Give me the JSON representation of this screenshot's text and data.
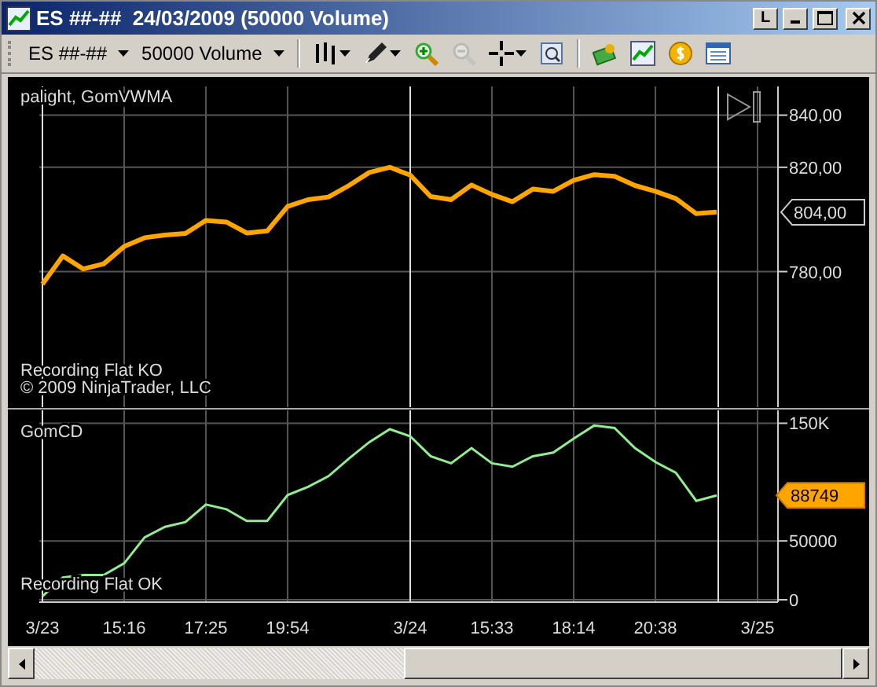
{
  "window": {
    "title": "ES ##-##  24/03/2009 (50000 Volume)",
    "link_button": "L"
  },
  "toolbar": {
    "instrument": "ES ##-##",
    "period": "50000 Volume",
    "tools": [
      {
        "kind": "bars",
        "caret": true,
        "disabled": false
      },
      {
        "kind": "pencil",
        "caret": true,
        "disabled": false
      },
      {
        "kind": "zoom_in",
        "caret": false,
        "disabled": false
      },
      {
        "kind": "zoom_out",
        "caret": false,
        "disabled": true
      },
      {
        "kind": "crosshair",
        "caret": true,
        "disabled": false
      },
      {
        "kind": "properties",
        "caret": false,
        "disabled": false
      },
      {
        "kind": "separator"
      },
      {
        "kind": "money",
        "caret": false,
        "disabled": false
      },
      {
        "kind": "chart",
        "caret": false,
        "disabled": false
      },
      {
        "kind": "coin",
        "caret": false,
        "disabled": false
      },
      {
        "kind": "table",
        "caret": false,
        "disabled": false
      }
    ]
  },
  "price_panel": {
    "label": "palight, GomVWMA",
    "notes": [
      "Recording Flat KO",
      "© 2009 NinjaTrader, LLC"
    ],
    "last_value": "804,00",
    "chart_data": {
      "type": "line",
      "grid": true,
      "series": [
        {
          "color": "#ffa500",
          "values": [
            775.2,
            786,
            781,
            783,
            789.6,
            793,
            794,
            794.6,
            799.6,
            799,
            794.8,
            795.6,
            805,
            807.6,
            808.6,
            813,
            818,
            820,
            817,
            808.8,
            807.6,
            813.2,
            809.6,
            806.8,
            811.6,
            810.8,
            815,
            817.2,
            816.6,
            813,
            810.8,
            808,
            802.2,
            802.8,
            null,
            null
          ]
        }
      ],
      "ylim": [
        728,
        851
      ],
      "yticks": [
        {
          "value": 780,
          "label": "780,00"
        },
        {
          "value": 820,
          "label": "820,00"
        },
        {
          "value": 840,
          "label": "840,00"
        }
      ]
    }
  },
  "indicator_panel": {
    "note": "Recording Flat OK",
    "last_value": "88749",
    "chart_data": {
      "type": "line",
      "grid": true,
      "categories": [
        "3/23",
        null,
        null,
        null,
        "15:16",
        null,
        null,
        null,
        "17:25",
        null,
        null,
        null,
        "19:54",
        null,
        null,
        null,
        null,
        null,
        "3/24",
        null,
        null,
        null,
        "15:33",
        null,
        null,
        null,
        "18:14",
        null,
        null,
        null,
        "20:38",
        null,
        null,
        null,
        null,
        "3/25"
      ],
      "series": [
        {
          "name": "GomCD",
          "color": "#90ee90",
          "values": [
            3000,
            19000,
            21000,
            21000,
            31000,
            53000,
            62000,
            66000,
            81000,
            77000,
            67000,
            67000,
            89000,
            96000,
            105000,
            120000,
            134000,
            145000,
            139000,
            122000,
            116000,
            129000,
            116000,
            113000,
            122000,
            125000,
            137000,
            148000,
            146000,
            129000,
            117000,
            108000,
            84000,
            88749,
            null,
            null
          ]
        }
      ],
      "ylim": [
        -2000,
        161000
      ],
      "yticks": [
        {
          "value": 0,
          "label": "0"
        },
        {
          "value": 50000,
          "label": "50000"
        },
        {
          "value": 150000,
          "label": "150K"
        }
      ]
    }
  }
}
